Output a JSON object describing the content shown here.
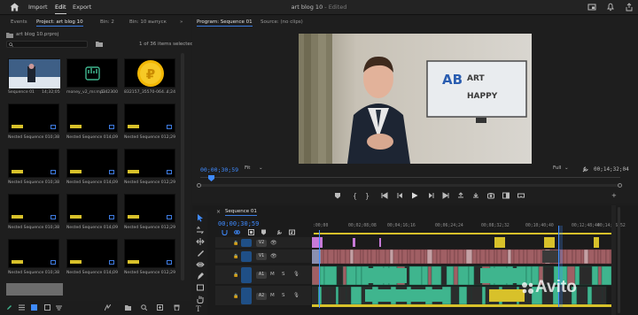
{
  "app": {
    "menu": [
      "Import",
      "Edit",
      "Export"
    ],
    "active_menu": "Edit",
    "title": "art blog 10",
    "title_state": " - Edited"
  },
  "project_panel": {
    "tabs": [
      "Events",
      "Project: art blog 10",
      "Bin: 2",
      "Bin: 10 выпуск"
    ],
    "active_tab": "Project: art blog 10",
    "path": "art blog 10.prproj",
    "search_placeholder": "",
    "items_selected": "1 of 36 items selected",
    "items": [
      {
        "name": "Sequence 01",
        "duration": "14;32;05",
        "kind": "sequence"
      },
      {
        "name": "money_v2_mr.mp3",
        "duration": "1:42300",
        "kind": "audio"
      },
      {
        "name": "832157_35570-064...",
        "duration": "4;24",
        "kind": "coin"
      },
      {
        "name": "Nested Sequence 01",
        "duration": "0;38",
        "kind": "nested"
      },
      {
        "name": "Nested Sequence 01 ...",
        "duration": "4;09",
        "kind": "nested"
      },
      {
        "name": "Nested Sequence 01 ...",
        "duration": "2;29",
        "kind": "nested"
      },
      {
        "name": "Nested Sequence 01",
        "duration": "0;38",
        "kind": "nested"
      },
      {
        "name": "Nested Sequence 01 ...",
        "duration": "4;09",
        "kind": "nested"
      },
      {
        "name": "Nested Sequence 01 ...",
        "duration": "2;29",
        "kind": "nested"
      },
      {
        "name": "Nested Sequence 01",
        "duration": "0;38",
        "kind": "nested"
      },
      {
        "name": "Nested Sequence 01 ...",
        "duration": "4;09",
        "kind": "nested"
      },
      {
        "name": "Nested Sequence 01 ...",
        "duration": "2;29",
        "kind": "nested"
      },
      {
        "name": "Nested Sequence 01",
        "duration": "0;38",
        "kind": "nested"
      },
      {
        "name": "Nested Sequence 01 ...",
        "duration": "4;09",
        "kind": "nested"
      },
      {
        "name": "Nested Sequence 01 ...",
        "duration": "2;29",
        "kind": "nested"
      }
    ]
  },
  "program_monitor": {
    "tabs": [
      "Program: Sequence 01",
      "Source: (no clips)"
    ],
    "active_tab": "Program: Sequence 01",
    "timecode_current": "00;00;30;59",
    "fit": "Fit",
    "quality": "Full",
    "timecode_duration": "00;14;32;04",
    "screen_text": {
      "line1": "ART",
      "line2": "HAPPY",
      "logo": "AB"
    }
  },
  "timeline": {
    "tab": "Sequence 01",
    "timecode": "00;00;30;59",
    "ruler": [
      ":00;00",
      "00;02;08;08",
      "00;04;16;16",
      "00;06;24;24",
      "00;08;32;32",
      "00;10;40;40",
      "00;12;48;44",
      "00;14;56;52"
    ],
    "video_tracks": [
      "V2",
      "V1"
    ],
    "audio_tracks": [
      "A1",
      "A2"
    ],
    "track_buttons": [
      "M",
      "S"
    ]
  },
  "watermark": "Avito",
  "colors": {
    "accent_blue": "#3f8bff",
    "clip_video": "#a05f64",
    "clip_audio": "#3fb58e",
    "clip_purple": "#c77ad8",
    "clip_yellow": "#d8c12a"
  }
}
